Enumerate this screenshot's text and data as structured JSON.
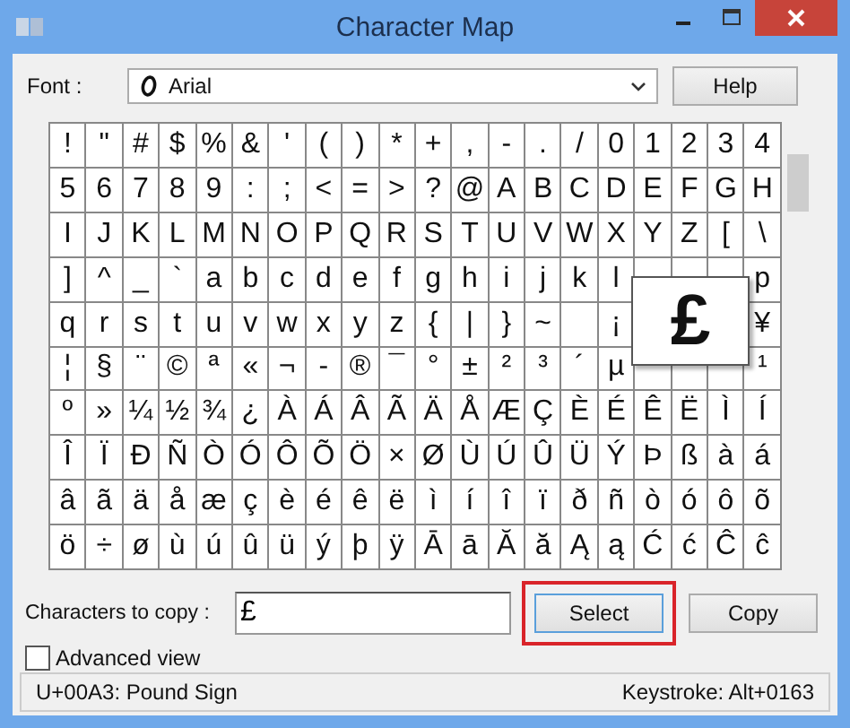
{
  "window": {
    "title": "Character Map"
  },
  "font": {
    "label": "Font :",
    "value": "Arial"
  },
  "help_button": "Help",
  "grid": {
    "rows": [
      [
        "!",
        "\"",
        "#",
        "$",
        "%",
        "&",
        "'",
        "(",
        ")",
        "*",
        "+",
        ",",
        "-",
        ".",
        "/",
        "0",
        "1",
        "2",
        "3",
        "4"
      ],
      [
        "5",
        "6",
        "7",
        "8",
        "9",
        ":",
        ";",
        "<",
        "=",
        ">",
        "?",
        "@",
        "A",
        "B",
        "C",
        "D",
        "E",
        "F",
        "G",
        "H"
      ],
      [
        "I",
        "J",
        "K",
        "L",
        "M",
        "N",
        "O",
        "P",
        "Q",
        "R",
        "S",
        "T",
        "U",
        "V",
        "W",
        "X",
        "Y",
        "Z",
        "[",
        "\\"
      ],
      [
        "]",
        "^",
        "_",
        "`",
        "a",
        "b",
        "c",
        "d",
        "e",
        "f",
        "g",
        "h",
        "i",
        "j",
        "k",
        "l",
        null,
        null,
        null,
        "p"
      ],
      [
        "q",
        "r",
        "s",
        "t",
        "u",
        "v",
        "w",
        "x",
        "y",
        "z",
        "{",
        "|",
        "}",
        "~",
        null,
        "¡",
        null,
        null,
        null,
        "¥"
      ],
      [
        "¦",
        "§",
        "¨",
        "©",
        "ª",
        "«",
        "¬",
        "-",
        "®",
        "¯",
        "°",
        "±",
        "²",
        "³",
        "´",
        "µ",
        null,
        null,
        null,
        "¹"
      ],
      [
        "º",
        "»",
        "¼",
        "½",
        "¾",
        "¿",
        "À",
        "Á",
        "Â",
        "Ã",
        "Ä",
        "Å",
        "Æ",
        "Ç",
        "È",
        "É",
        "Ê",
        "Ë",
        "Ì",
        "Í"
      ],
      [
        "Î",
        "Ï",
        "Ð",
        "Ñ",
        "Ò",
        "Ó",
        "Ô",
        "Õ",
        "Ö",
        "×",
        "Ø",
        "Ù",
        "Ú",
        "Û",
        "Ü",
        "Ý",
        "Þ",
        "ß",
        "à",
        "á"
      ],
      [
        "â",
        "ã",
        "ä",
        "å",
        "æ",
        "ç",
        "è",
        "é",
        "ê",
        "ë",
        "ì",
        "í",
        "î",
        "ï",
        "ð",
        "ñ",
        "ò",
        "ó",
        "ô",
        "õ"
      ],
      [
        "ö",
        "÷",
        "ø",
        "ù",
        "ú",
        "û",
        "ü",
        "ý",
        "þ",
        "ÿ",
        "Ā",
        "ā",
        "Ă",
        "ă",
        "Ą",
        "ą",
        "Ć",
        "ć",
        "Ĉ",
        "ĉ"
      ]
    ],
    "enlarged": "£"
  },
  "copy": {
    "label": "Characters to copy :",
    "value": "£"
  },
  "buttons": [
    {
      "label": "Select",
      "highlighted": true
    },
    {
      "label": "Copy",
      "highlighted": false
    }
  ],
  "advanced_view": {
    "label": "Advanced view",
    "checked": false
  },
  "status_bar": {
    "left": "U+00A3: Pound Sign",
    "right": "Keystroke: Alt+0163"
  }
}
